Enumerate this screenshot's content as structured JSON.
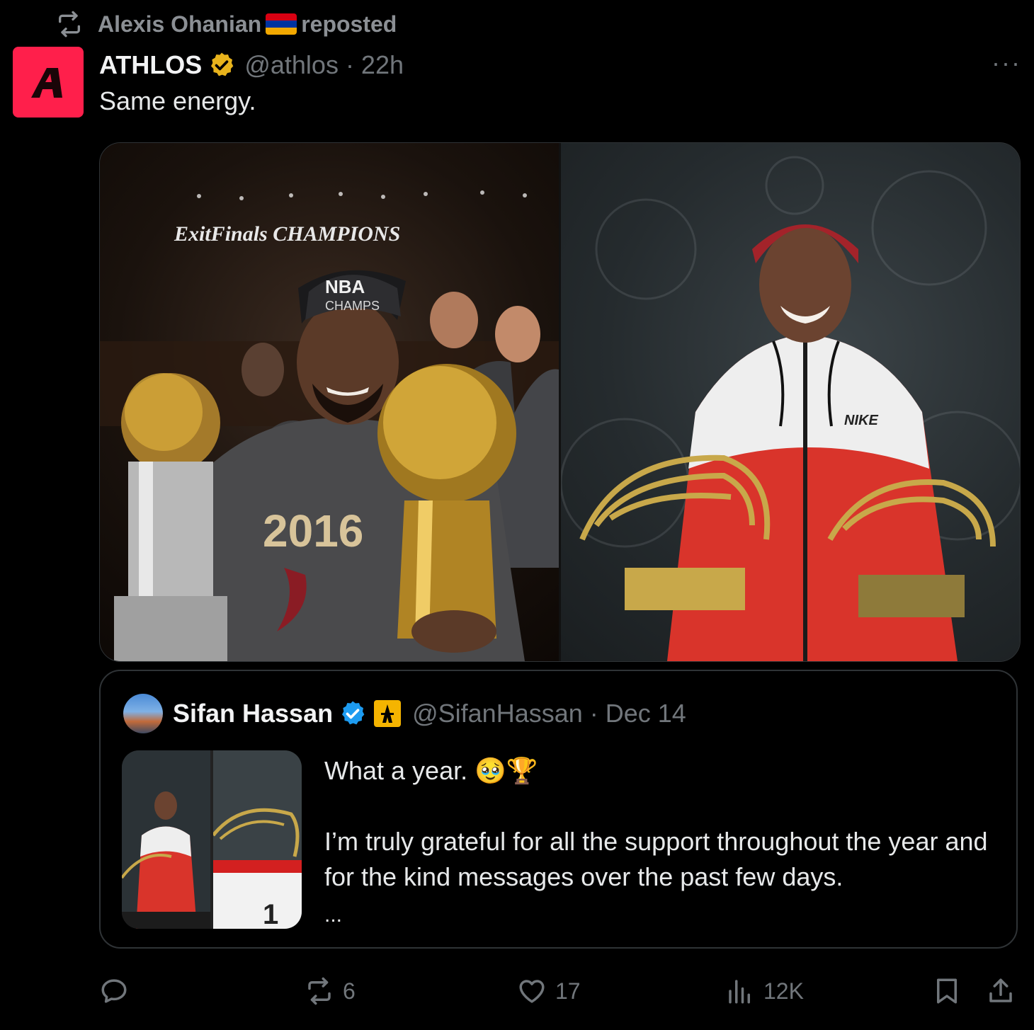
{
  "repost": {
    "user": "Alexis Ohanian",
    "label": "reposted",
    "flag_colors": [
      "#d90012",
      "#0033a0",
      "#f2a800"
    ]
  },
  "tweet": {
    "author": "ATHLOS",
    "handle": "@athlos · 22h",
    "text": "Same energy.",
    "more_label": "···",
    "avatar_color": "#ff1f4b",
    "media": {
      "left_banner": "ExitFinals CHAMPIONS",
      "left_cap": "NBA CHAMPS",
      "left_shirt": "2016"
    }
  },
  "quoted": {
    "author": "Sifan Hassan",
    "handle": "@SifanHassan · Dec 14",
    "line1": "What a year. 🥹🏆",
    "line2": "I’m truly grateful for all the support throughout the year and for the kind messages over the past few days.",
    "ellipsis": "...",
    "thumb_number": "1"
  },
  "actions": {
    "reply_count": "",
    "repost_count": "6",
    "like_count": "17",
    "views_count": "12K"
  },
  "icons": {
    "repost": "repost-icon",
    "verified_gold": "verified-gold-icon",
    "verified_blue": "verified-blue-icon",
    "reply": "reply-icon",
    "like": "heart-icon",
    "views": "views-icon",
    "bookmark": "bookmark-icon",
    "share": "share-icon"
  }
}
